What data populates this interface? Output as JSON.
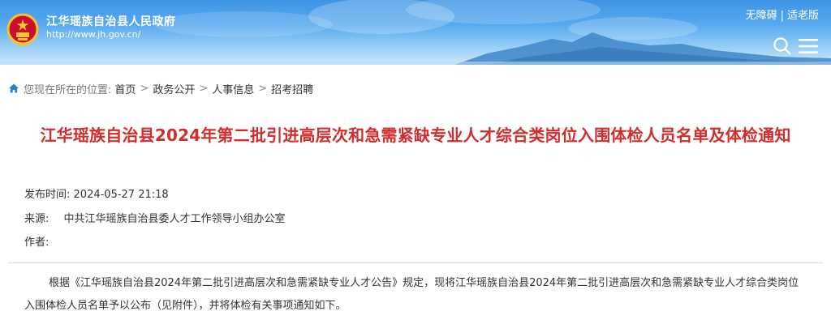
{
  "header": {
    "site_name": "江华瑶族自治县人民政府",
    "site_url": "http://www.jh.gov.cn/",
    "accessibility_link": "无障碍",
    "separator": "|",
    "elderly_link": "适老版",
    "icons": {
      "emblem": "national-emblem-icon",
      "search": "search-icon",
      "menu": "menu-icon"
    },
    "colors": {
      "sky_top": "#3f95e6",
      "sky_bottom": "#cfe8fb",
      "mountain": "#2f7fc4"
    }
  },
  "breadcrumb": {
    "prefix": "您现在所在的位置:",
    "items": [
      "首页",
      "政务公开",
      "人事信息",
      "招考招聘"
    ],
    "separator": ">",
    "icon": "home-icon"
  },
  "article": {
    "title": "江华瑶族自治县2024年第二批引进高层次和急需紧缺专业人才综合类岗位入围体检人员名单及体检通知",
    "title_color": "#d52b2b",
    "date_label": "发布时间:",
    "date_value": "2024-05-27 21:18",
    "source_label": "来源:",
    "source_value": "中共江华瑶族自治县委人才工作领导小组办公室",
    "author_label": "作者:",
    "author_value": "",
    "body": "根据《江华瑶族自治县2024年第二批引进高层次和急需紧缺专业人才公告》规定，现将江华瑶族自治县2024年第二批引进高层次和急需紧缺专业人才综合类岗位入围体检人员名单予以公布（见附件），并将体检有关事项通知如下。"
  }
}
